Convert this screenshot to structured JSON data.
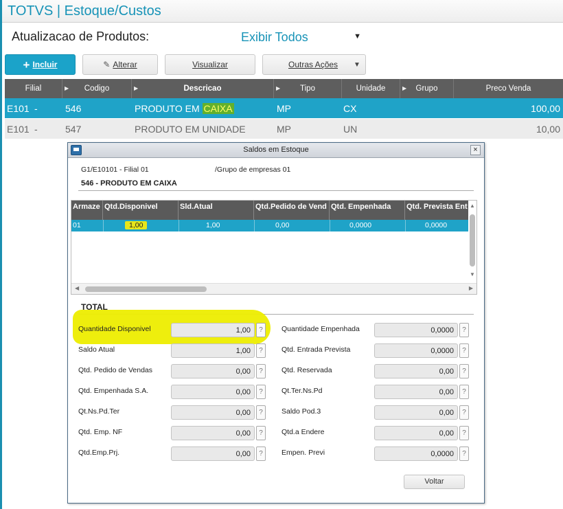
{
  "app": {
    "title": "TOTVS | Estoque/Custos"
  },
  "header": {
    "title": "Atualizacao de Produtos:",
    "filter_value": "Exibir Todos"
  },
  "toolbar": {
    "incluir": "Incluir",
    "alterar": "Alterar",
    "visualizar": "Visualizar",
    "outras_acoes": "Outras Ações"
  },
  "grid": {
    "columns": [
      "Filial",
      "Codigo",
      "Descricao",
      "Tipo",
      "Unidade",
      "Grupo",
      "Preco Venda"
    ],
    "rows": [
      {
        "filial": "E101",
        "dash": "-",
        "codigo": "546",
        "descricao_pre": "PRODUTO EM ",
        "descricao_hl": "CAIXA",
        "tipo": "MP",
        "unidade": "CX",
        "preco": "100,00"
      },
      {
        "filial": "E101",
        "dash": "-",
        "codigo": "547",
        "descricao_pre": "PRODUTO EM UNIDADE",
        "descricao_hl": "",
        "tipo": "MP",
        "unidade": "UN",
        "preco": "10,00"
      }
    ]
  },
  "dialog": {
    "title": "Saldos em Estoque",
    "close": "×",
    "info_left": "G1/E10101 - Filial 01",
    "info_right": "/Grupo de empresas 01",
    "product": "546 - PRODUTO EM CAIXA",
    "inner_columns": [
      "Armaze",
      "Qtd.Disponivel",
      "Sld.Atual",
      "Qtd.Pedido de Vend",
      "Qtd. Empenhada",
      "Qtd. Prevista Ent"
    ],
    "inner_row": [
      "01",
      "1,00",
      "1,00",
      "0,00",
      "0,0000",
      "0,0000"
    ],
    "total_title": "TOTAL",
    "fields_left": [
      {
        "label": "Quantidade Disponivel",
        "value": "1,00"
      },
      {
        "label": "Saldo Atual",
        "value": "1,00"
      },
      {
        "label": "Qtd. Pedido de Vendas",
        "value": "0,00"
      },
      {
        "label": "Qtd. Empenhada S.A.",
        "value": "0,00"
      },
      {
        "label": "Qt.Ns.Pd.Ter",
        "value": "0,00"
      },
      {
        "label": "Qtd. Emp. NF",
        "value": "0,00"
      },
      {
        "label": "Qtd.Emp.Prj.",
        "value": "0,00"
      }
    ],
    "fields_right": [
      {
        "label": "Quantidade Empenhada",
        "value": "0,0000"
      },
      {
        "label": "Qtd. Entrada Prevista",
        "value": "0,0000"
      },
      {
        "label": "Qtd. Reservada",
        "value": "0,00"
      },
      {
        "label": "Qt.Ter.Ns.Pd",
        "value": "0,00"
      },
      {
        "label": "Saldo Pod.3",
        "value": "0,00"
      },
      {
        "label": "Qtd.a Endere",
        "value": "0,00"
      },
      {
        "label": "Empen. Previ",
        "value": "0,0000"
      }
    ],
    "help": "?",
    "voltar": "Voltar"
  },
  "colors": {
    "accent": "#1ba3c9",
    "highlight": "#e6e61a",
    "header_dark": "#5e5e5e"
  }
}
